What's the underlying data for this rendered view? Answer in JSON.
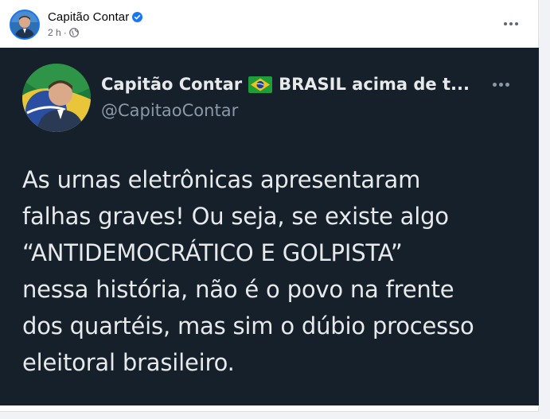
{
  "post": {
    "author_name": "Capitão Contar",
    "time": "2 h",
    "meta_separator": "·",
    "more_icon": "more-horizontal-icon",
    "verified_icon": "verified-badge-icon",
    "privacy_icon": "globe-icon"
  },
  "tweet": {
    "display_name": "Capitão Contar",
    "flag": "brazil-flag-icon",
    "motto_truncated": "BRASIL acima de t...",
    "handle": "@CapitaoContar",
    "more_icon": "more-horizontal-icon",
    "text_lines": [
      "As urnas eletrônicas apresentaram",
      "falhas graves! Ou seja, se existe algo",
      "“ANTIDEMOCRÁTICO E GOLPISTA”",
      "nessa história, não é o povo na frente",
      "dos quartéis, mas sim o dúbio processo",
      "eleitoral brasileiro."
    ]
  },
  "colors": {
    "facebook_blue": "#1877f2",
    "tweet_background": "#15202b",
    "tweet_text": "#e7e9ea",
    "tweet_secondary": "#8b98a5",
    "fb_secondary": "#65676b"
  }
}
